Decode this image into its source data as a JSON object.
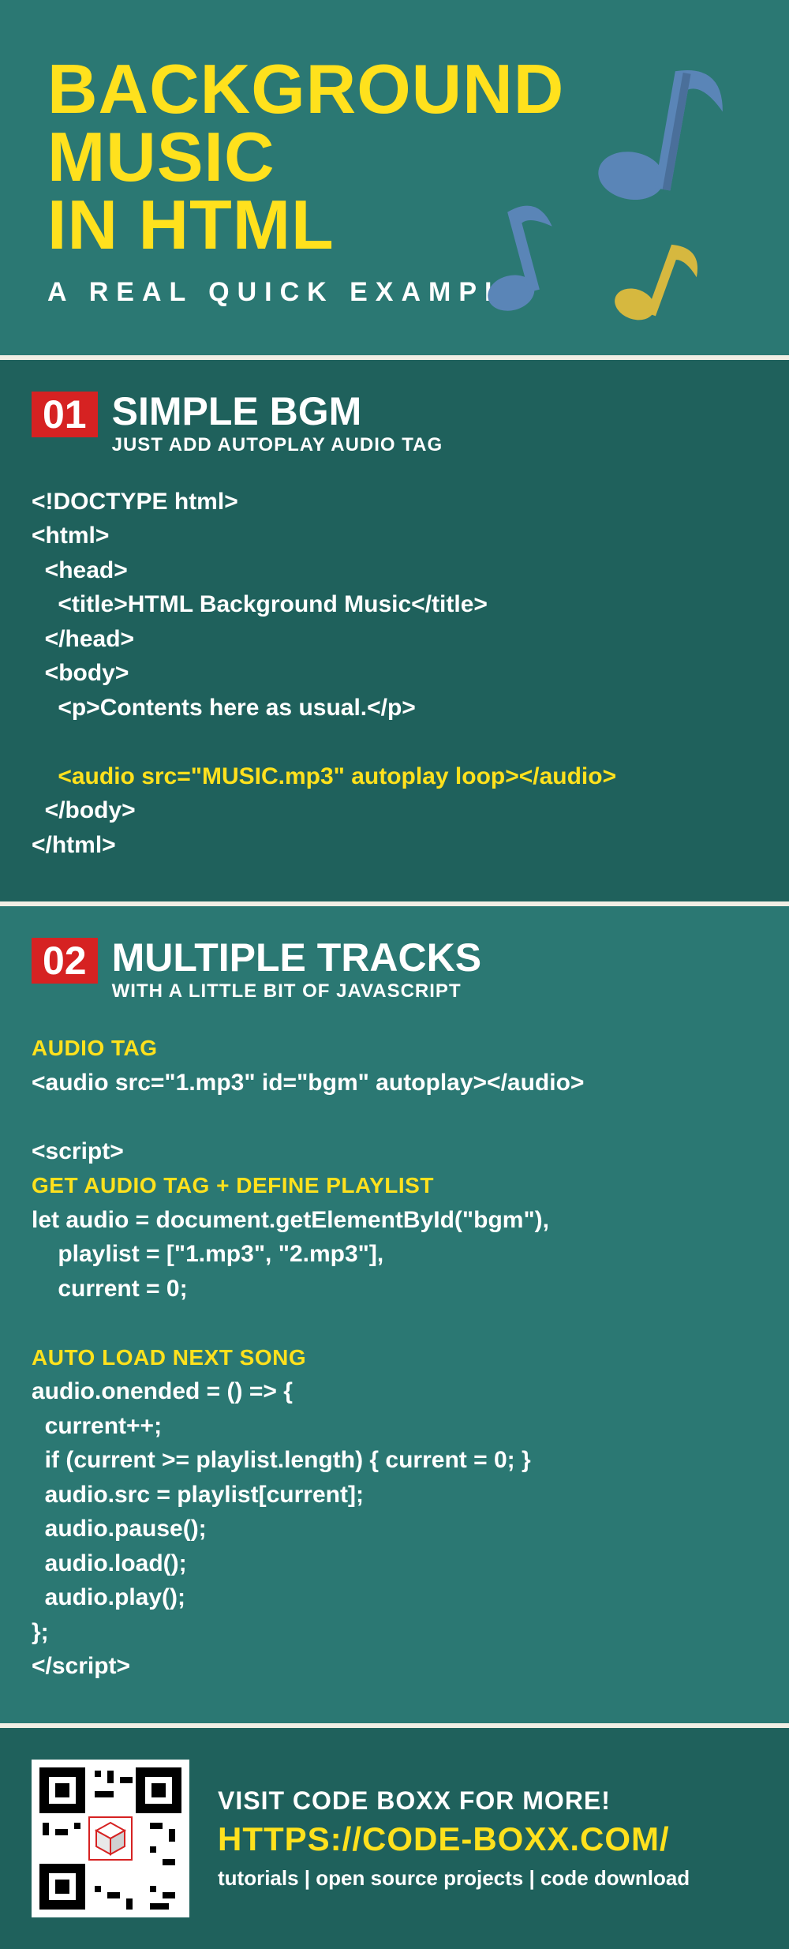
{
  "header": {
    "title_line1": "BACKGROUND",
    "title_line2": "MUSIC",
    "title_line3": "IN HTML",
    "subtitle": "A REAL QUICK EXAMPLE"
  },
  "section1": {
    "num": "01",
    "title": "SIMPLE BGM",
    "subtitle": "JUST ADD AUTOPLAY AUDIO TAG",
    "code_pre1": "<!DOCTYPE html>\n<html>\n  <head>\n    <title>HTML Background Music</title>\n  </head>\n  <body>\n    <p>Contents here as usual.</p>\n",
    "code_hl": "    <audio src=\"MUSIC.mp3\" autoplay loop></audio>",
    "code_post": "  </body>\n</html>"
  },
  "section2": {
    "num": "02",
    "title": "MULTIPLE TRACKS",
    "subtitle": "WITH A LITTLE BIT OF JAVASCRIPT",
    "label_audio": "AUDIO TAG",
    "code_audio": "<audio src=\"1.mp3\" id=\"bgm\" autoplay></audio>",
    "code_script_open": "<script>",
    "label_get": "GET AUDIO TAG + DEFINE PLAYLIST",
    "code_get": "let audio = document.getElementById(\"bgm\"),\n    playlist = [\"1.mp3\", \"2.mp3\"],\n    current = 0;",
    "label_auto": "AUTO LOAD NEXT SONG",
    "code_auto": "audio.onended = () => {\n  current++;\n  if (current >= playlist.length) { current = 0; }\n  audio.src = playlist[current];\n  audio.pause();\n  audio.load();\n  audio.play();\n};\n</script>"
  },
  "footer": {
    "visit": "VISIT CODE BOXX FOR MORE!",
    "url": "HTTPS://CODE-BOXX.COM/",
    "tags": "tutorials | open source projects | code download"
  }
}
